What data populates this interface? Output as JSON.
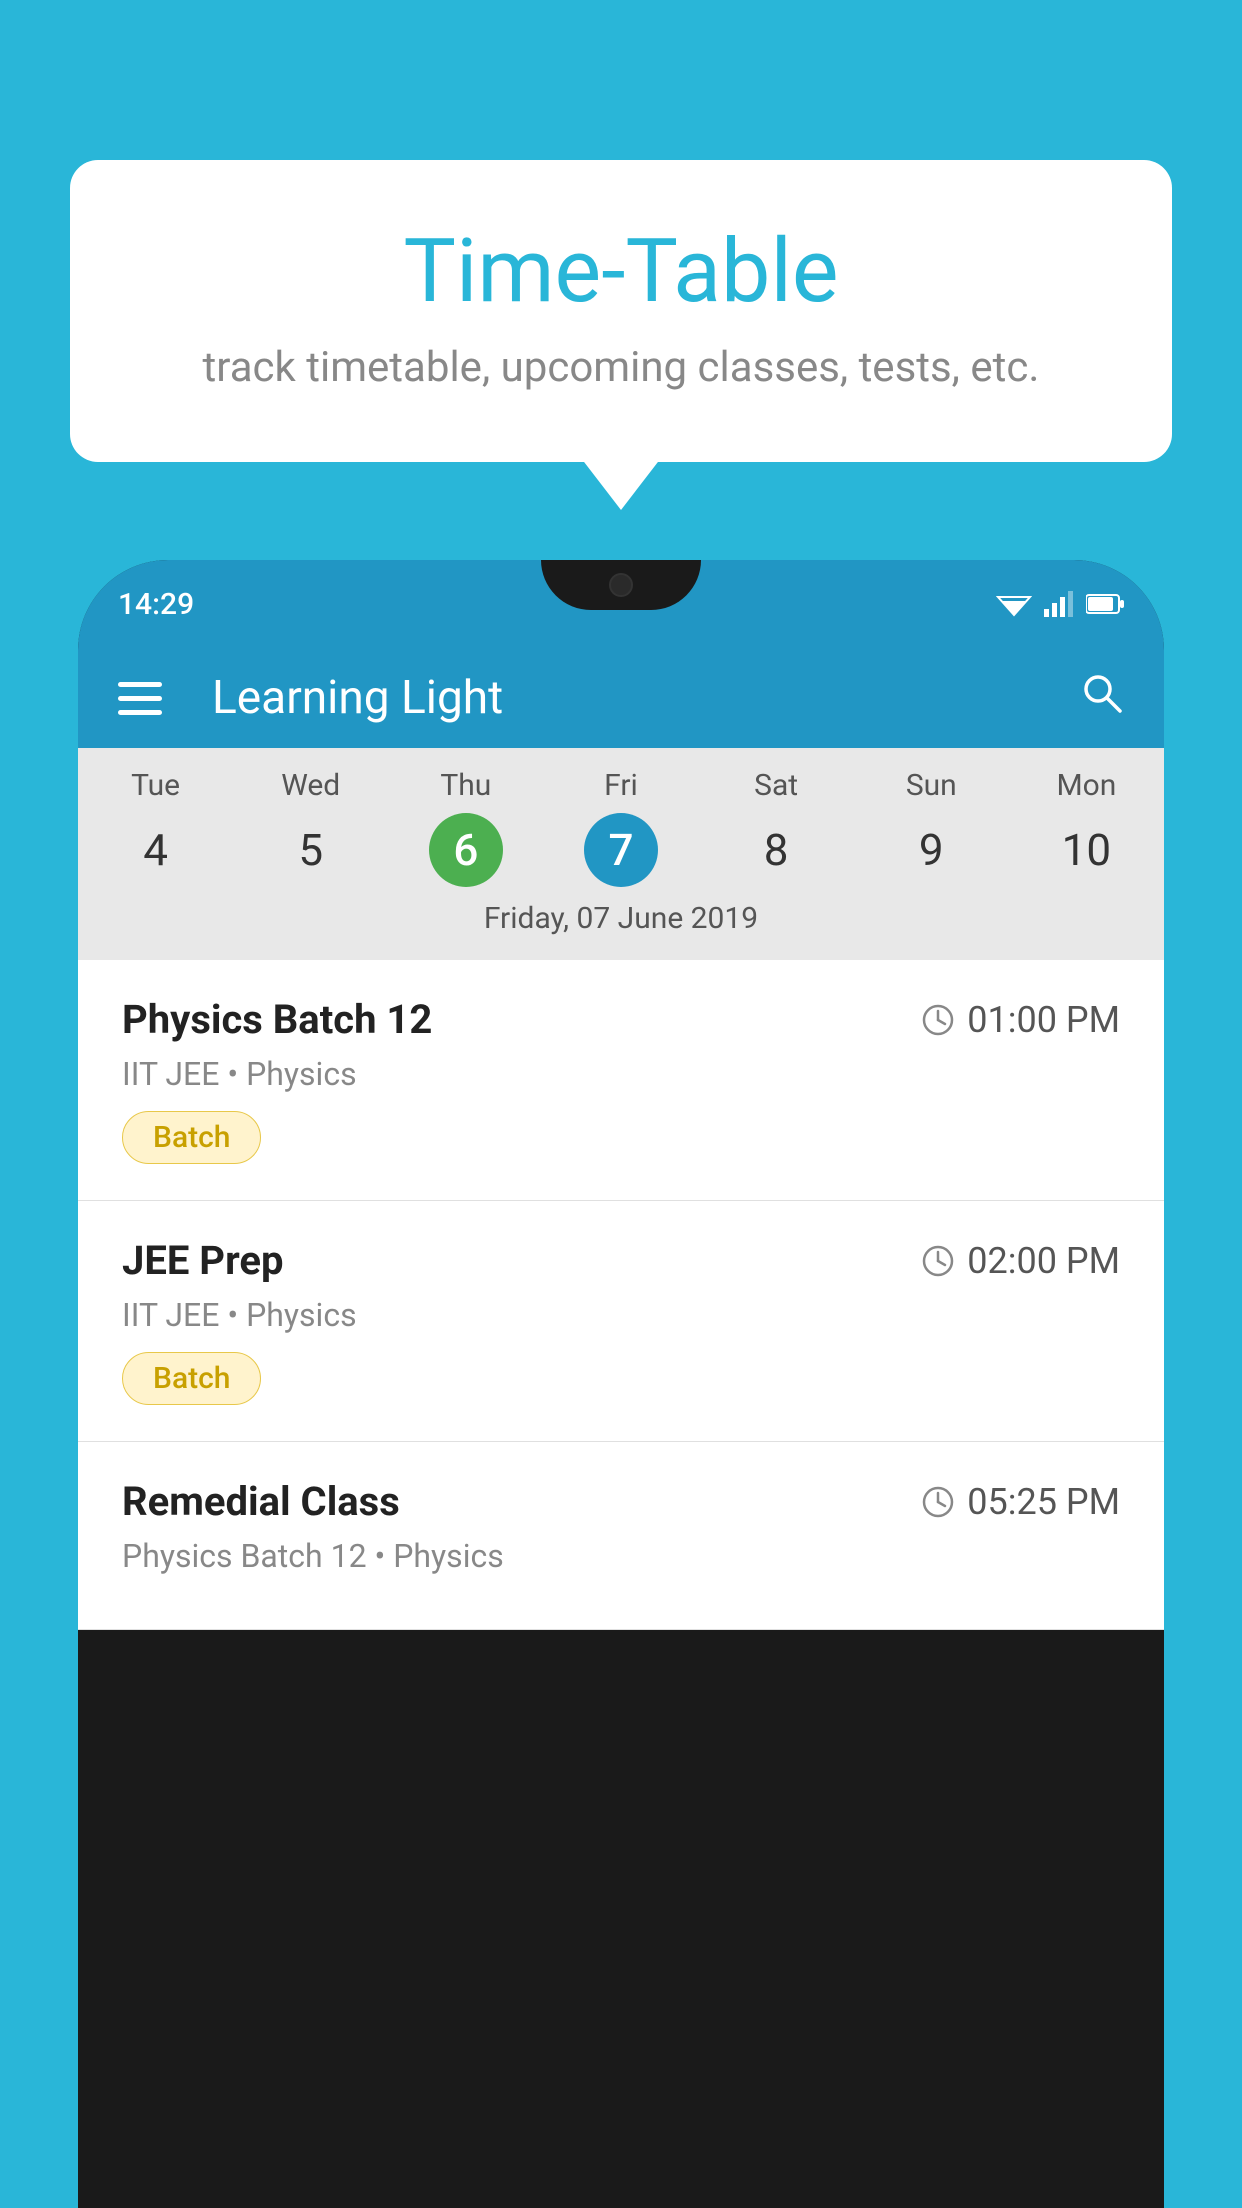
{
  "background_color": "#29b6d8",
  "speech_bubble": {
    "title": "Time-Table",
    "subtitle": "track timetable, upcoming classes, tests, etc."
  },
  "phone": {
    "status_bar": {
      "time": "14:29"
    },
    "app_bar": {
      "title": "Learning Light"
    },
    "calendar": {
      "day_labels": [
        "Tue",
        "Wed",
        "Thu",
        "Fri",
        "Sat",
        "Sun",
        "Mon"
      ],
      "day_numbers": [
        "4",
        "5",
        "6",
        "7",
        "8",
        "9",
        "10"
      ],
      "today_index": 2,
      "selected_index": 3,
      "current_date_label": "Friday, 07 June 2019"
    },
    "schedule_items": [
      {
        "title": "Physics Batch 12",
        "time": "01:00 PM",
        "subtitle": "IIT JEE • Physics",
        "badge": "Batch"
      },
      {
        "title": "JEE Prep",
        "time": "02:00 PM",
        "subtitle": "IIT JEE • Physics",
        "badge": "Batch"
      },
      {
        "title": "Remedial Class",
        "time": "05:25 PM",
        "subtitle": "Physics Batch 12 • Physics",
        "badge": null
      }
    ]
  },
  "icons": {
    "hamburger": "☰",
    "search": "🔍",
    "clock": "🕐"
  }
}
